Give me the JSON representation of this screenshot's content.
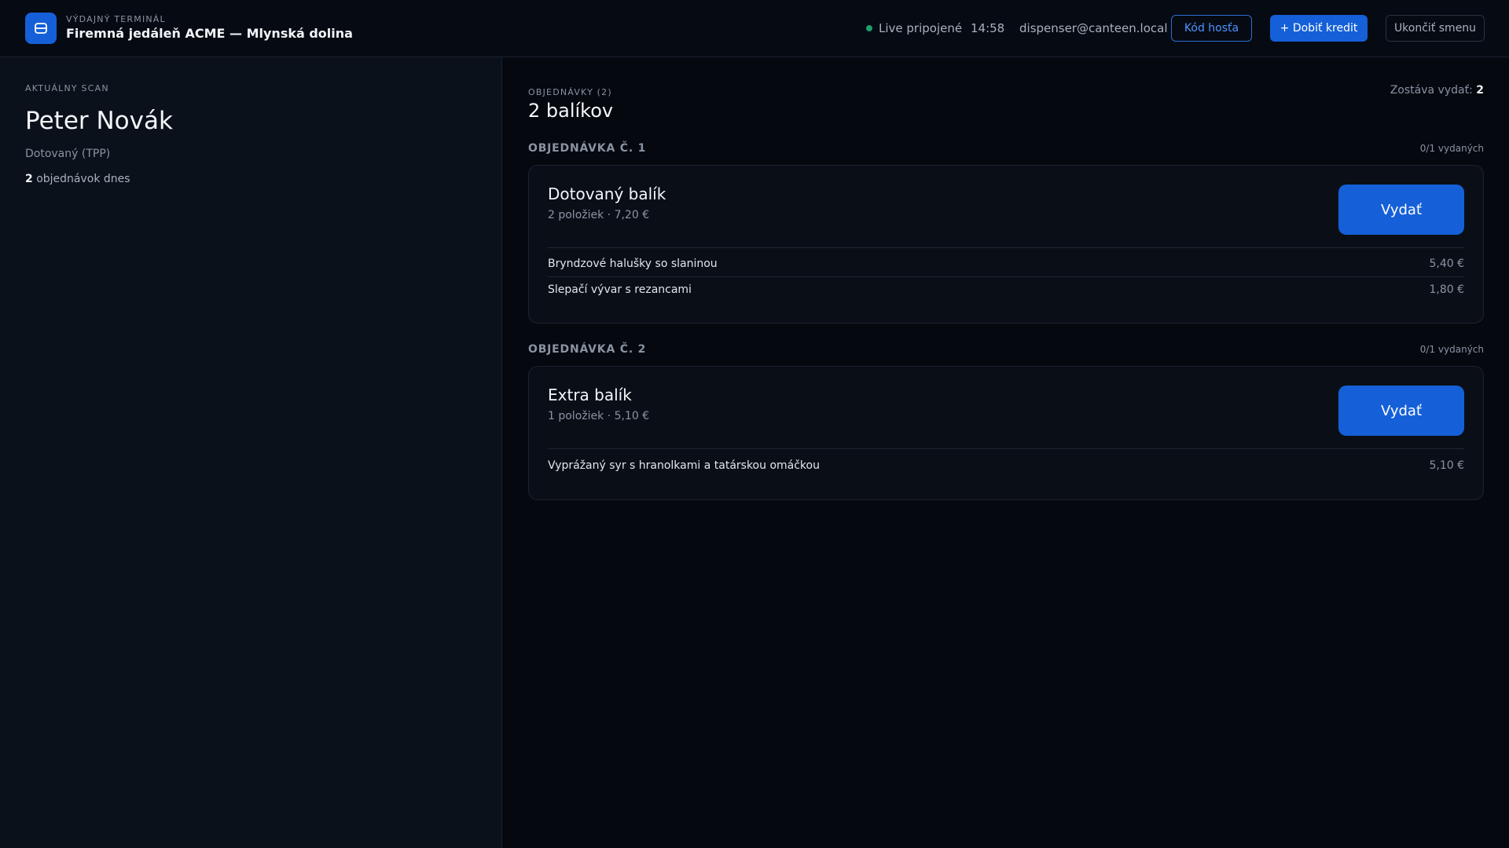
{
  "header": {
    "kicker": "VÝDAJNÝ TERMINÁL",
    "title": "Firemná jedáleň ACME — Mlynská dolina",
    "status": "Live pripojené",
    "time": "14:58",
    "user": "dispenser@canteen.local",
    "guest_code_label": "Kód hosťa",
    "top_up_label": "+ Dobiť kredit",
    "end_shift_label": "Ukončiť smenu",
    "status_color": "#1f9d6b",
    "accent_color": "#1560d8"
  },
  "scan": {
    "label": "AKTUÁLNY SCAN",
    "name": "Peter Novák",
    "type": "Dotovaný (TPP)",
    "orders_count": "2",
    "orders_suffix": "objednávok dnes"
  },
  "orders": {
    "kicker": "OBJEDNÁVKY (2)",
    "title": "2 balíkov",
    "remaining_label": "Zostáva vydať:",
    "remaining_value": "2",
    "list": [
      {
        "number": "OBJEDNÁVKA Č. 1",
        "issued": "0/1 vydaných",
        "package": "Dotovaný balík",
        "meta": "2 položiek · 7,20 €",
        "issue_label": "Vydať",
        "items": [
          {
            "name": "Bryndzové halušky so slaninou",
            "price": "5,40 €"
          },
          {
            "name": "Slepačí vývar s rezancami",
            "price": "1,80 €"
          }
        ]
      },
      {
        "number": "OBJEDNÁVKA Č. 2",
        "issued": "0/1 vydaných",
        "package": "Extra balík",
        "meta": "1 položiek · 5,10 €",
        "issue_label": "Vydať",
        "items": [
          {
            "name": "Vyprážaný syr s hranolkami a tatárskou omáčkou",
            "price": "5,10 €"
          }
        ]
      }
    ]
  }
}
